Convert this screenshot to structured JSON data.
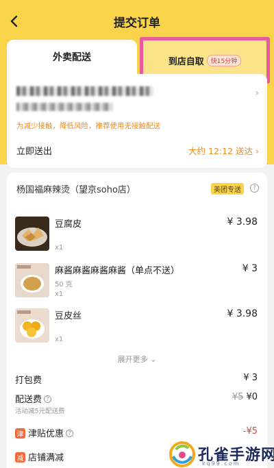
{
  "header": {
    "title": "提交订单",
    "back_icon": "chevron-left-icon"
  },
  "tabs": {
    "delivery_label": "外卖配送",
    "pickup_label": "到店自取",
    "pickup_badge": "快15分钟"
  },
  "address": {
    "tip": "为减少接触，降低风险，推荐使用无接触配送",
    "deliver_now": "立即送出",
    "eta": "大约 12:12 送达 ›"
  },
  "shop": {
    "name": "杨国福麻辣烫（望京soho店）",
    "badge": "美团专送"
  },
  "items": [
    {
      "name": "豆腐皮",
      "sub": "",
      "qty": "x1",
      "price": "¥ 3.98"
    },
    {
      "name": "麻酱麻酱麻酱麻酱（单点不送）",
      "sub": "50 克",
      "qty": "x1",
      "price": "¥ 3"
    },
    {
      "name": "豆皮丝",
      "sub": "",
      "qty": "x1",
      "price": "¥ 3.98"
    }
  ],
  "expand_label": "展开更多 ⌄",
  "fees": {
    "packing_label": "打包费",
    "packing_value": "¥ 3",
    "delivery_label": "配送费",
    "delivery_original": "¥5",
    "delivery_value": "¥0",
    "delivery_sub": "活动减5元配送费",
    "subsidy_label": "津贴优惠",
    "subsidy_icon": "津",
    "subsidy_value": "-¥5",
    "shop_discount_label": "店铺满减",
    "shop_discount_icon": "减"
  },
  "watermark": {
    "text": "孔雀手游网",
    "url": "kq99.com"
  },
  "colors": {
    "brand_yellow": "#f9d349",
    "accent_orange": "#f08a1c",
    "highlight_pink": "#e85a9c",
    "discount_red": "#e5432f"
  }
}
